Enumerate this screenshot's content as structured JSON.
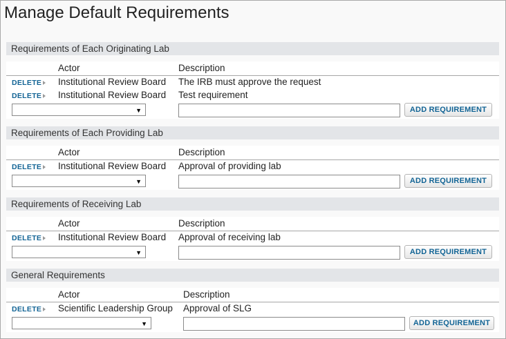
{
  "page_title": "Manage Default Requirements",
  "column_headers": {
    "actor": "Actor",
    "description": "Description"
  },
  "delete_label": "DELETE",
  "add_label": "ADD REQUIREMENT",
  "sections": [
    {
      "title": "Requirements of Each Originating Lab",
      "rows": [
        {
          "actor": "Institutional Review Board",
          "description": "The IRB must approve the request"
        },
        {
          "actor": "Institutional Review Board",
          "description": "Test requirement"
        }
      ]
    },
    {
      "title": "Requirements of Each Providing Lab",
      "rows": [
        {
          "actor": "Institutional Review Board",
          "description": "Approval of providing lab"
        }
      ]
    },
    {
      "title": "Requirements of Receiving Lab",
      "rows": [
        {
          "actor": "Institutional Review Board",
          "description": "Approval of receiving lab"
        }
      ]
    },
    {
      "title": "General Requirements",
      "rows": [
        {
          "actor": "Scientific Leadership Group",
          "description": "Approval of SLG"
        }
      ]
    }
  ],
  "colors": {
    "link": "#126495",
    "section_header_bg": "#e3e5e8"
  }
}
